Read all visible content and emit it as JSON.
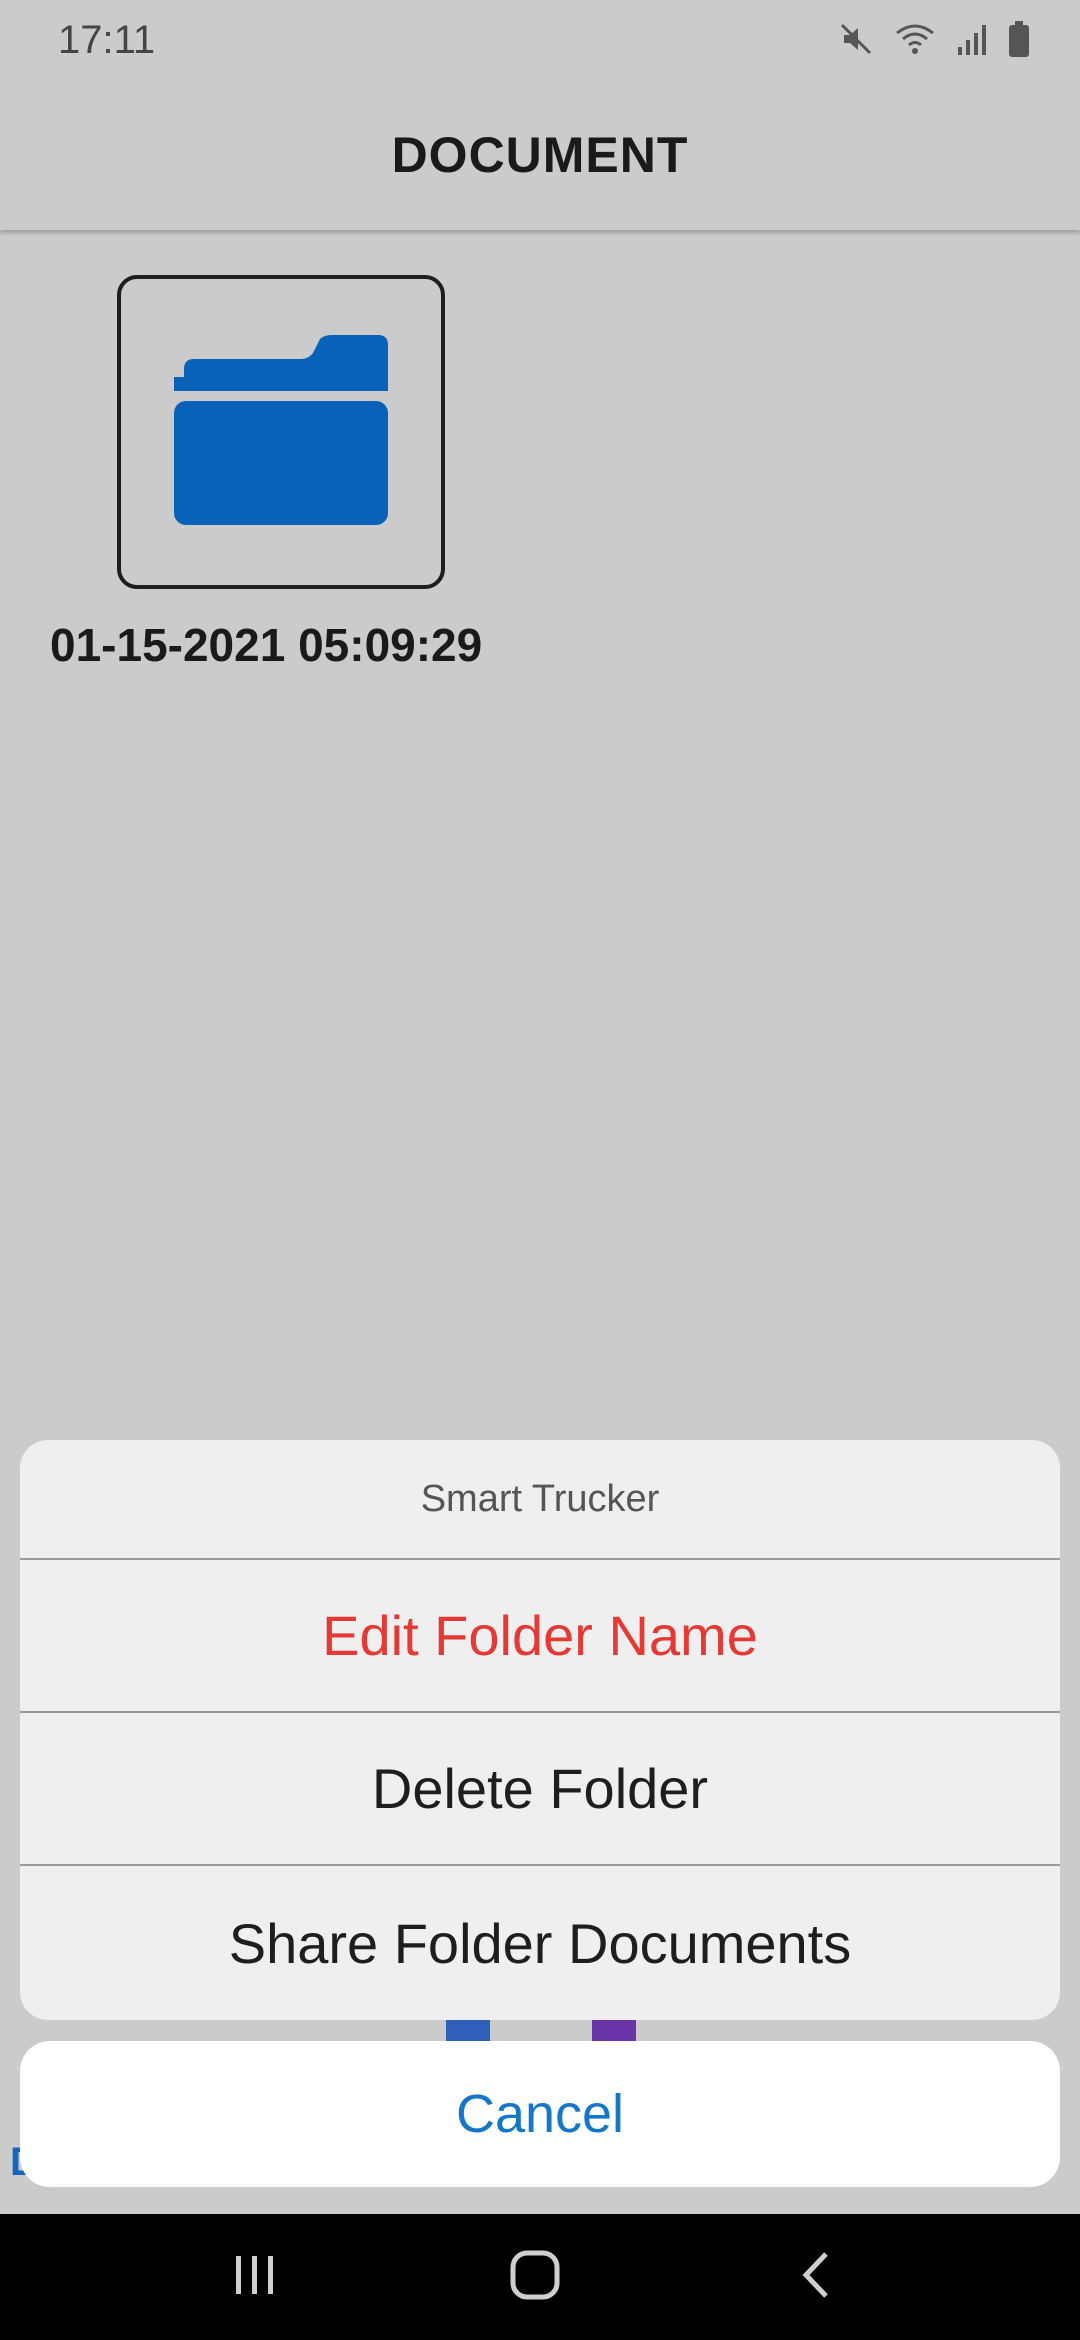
{
  "status_bar": {
    "time": "17:11",
    "icons": [
      "mute-icon",
      "wifi-icon",
      "signal-icon",
      "battery-icon"
    ]
  },
  "header": {
    "title": "DOCUMENT"
  },
  "folders": [
    {
      "name": "01-15-2021 05:09:29",
      "icon": "folder-icon",
      "icon_color": "#0a62b8"
    }
  ],
  "action_sheet": {
    "title": "Smart Trucker",
    "options": [
      {
        "label": "Edit Folder Name",
        "color": "#e53935"
      },
      {
        "label": "Delete Folder",
        "color": "#1e1e1e"
      },
      {
        "label": "Share Folder Documents",
        "color": "#1e1e1e"
      }
    ],
    "cancel_label": "Cancel"
  },
  "nav_bar": {
    "buttons": [
      "recent-apps-icon",
      "home-icon",
      "back-icon"
    ]
  }
}
